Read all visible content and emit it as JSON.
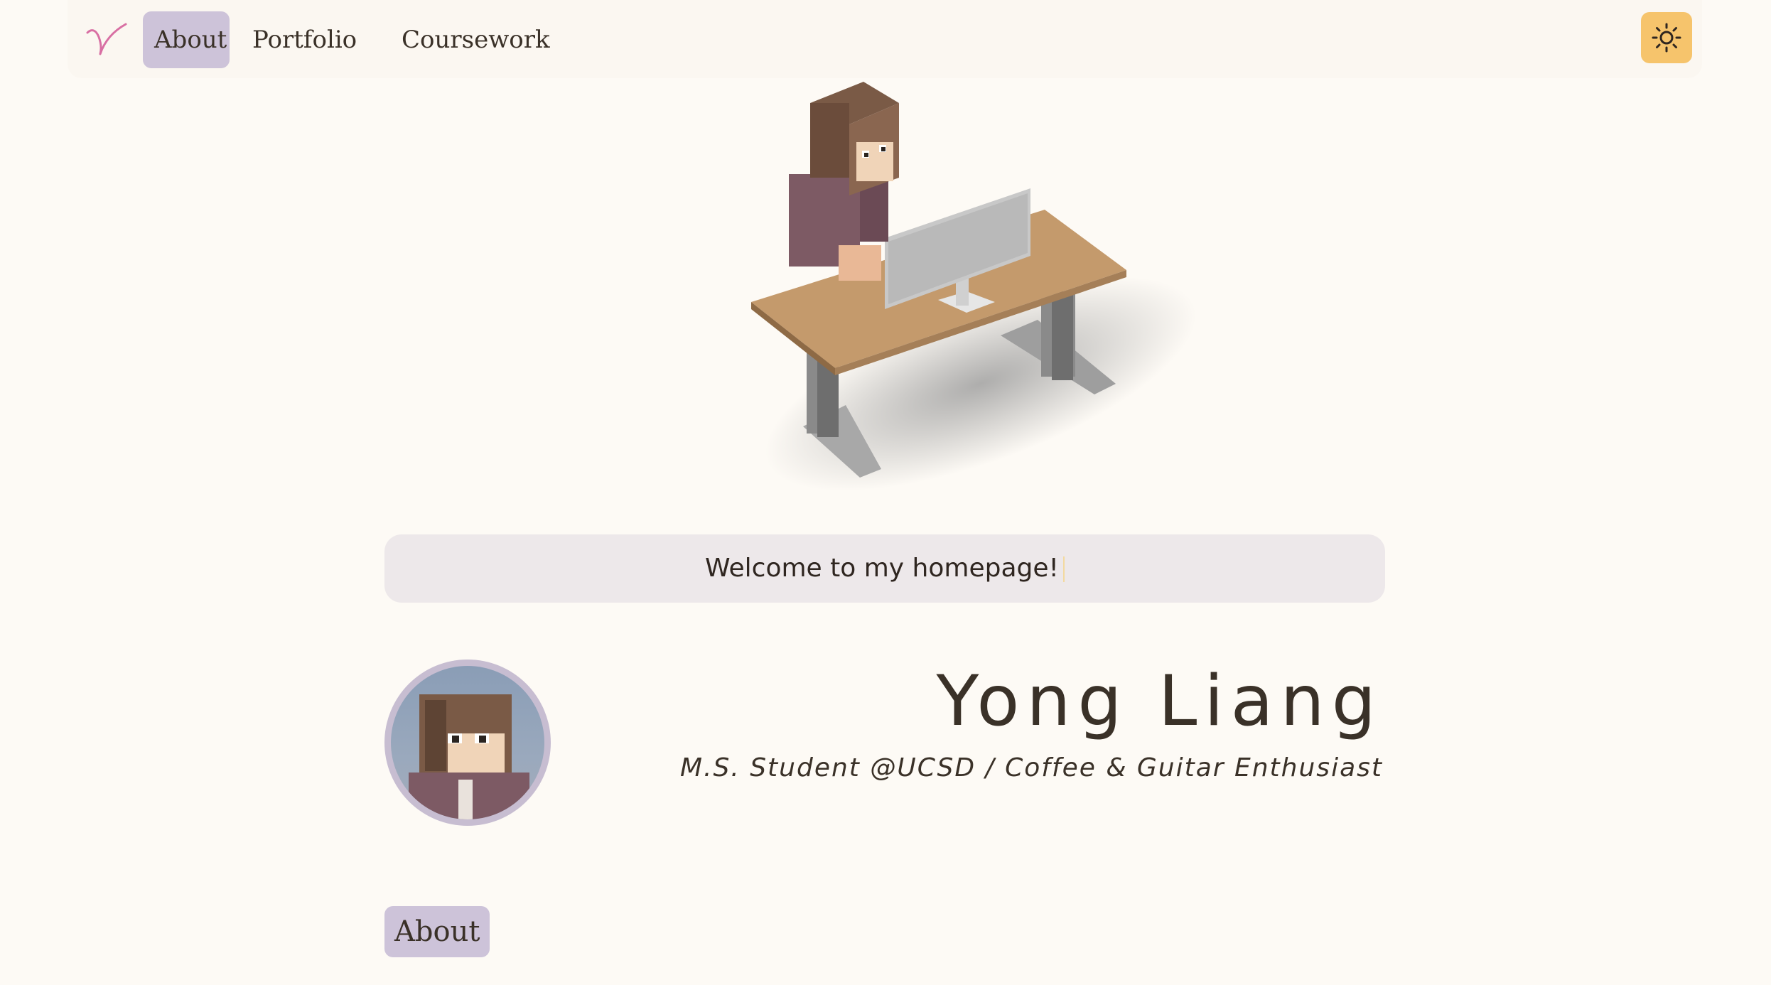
{
  "nav": {
    "logo_letter": "Y",
    "links": [
      "About",
      "Portfolio",
      "Coursework"
    ],
    "active": "About",
    "theme_icon": "sun-icon"
  },
  "hero": {
    "image": "minecraft-character-at-desk"
  },
  "welcome": {
    "text": "Welcome to my homepage!"
  },
  "profile": {
    "name": "Yong Liang",
    "tagline": "M.S. Student @UCSD / Coffee & Guitar Enthusiast",
    "avatar": "minecraft-avatar"
  },
  "section": {
    "label": "About"
  },
  "colors": {
    "background": "#fdfaf5",
    "accent": "#cdc3d9",
    "theme_button": "#f6c46c"
  }
}
